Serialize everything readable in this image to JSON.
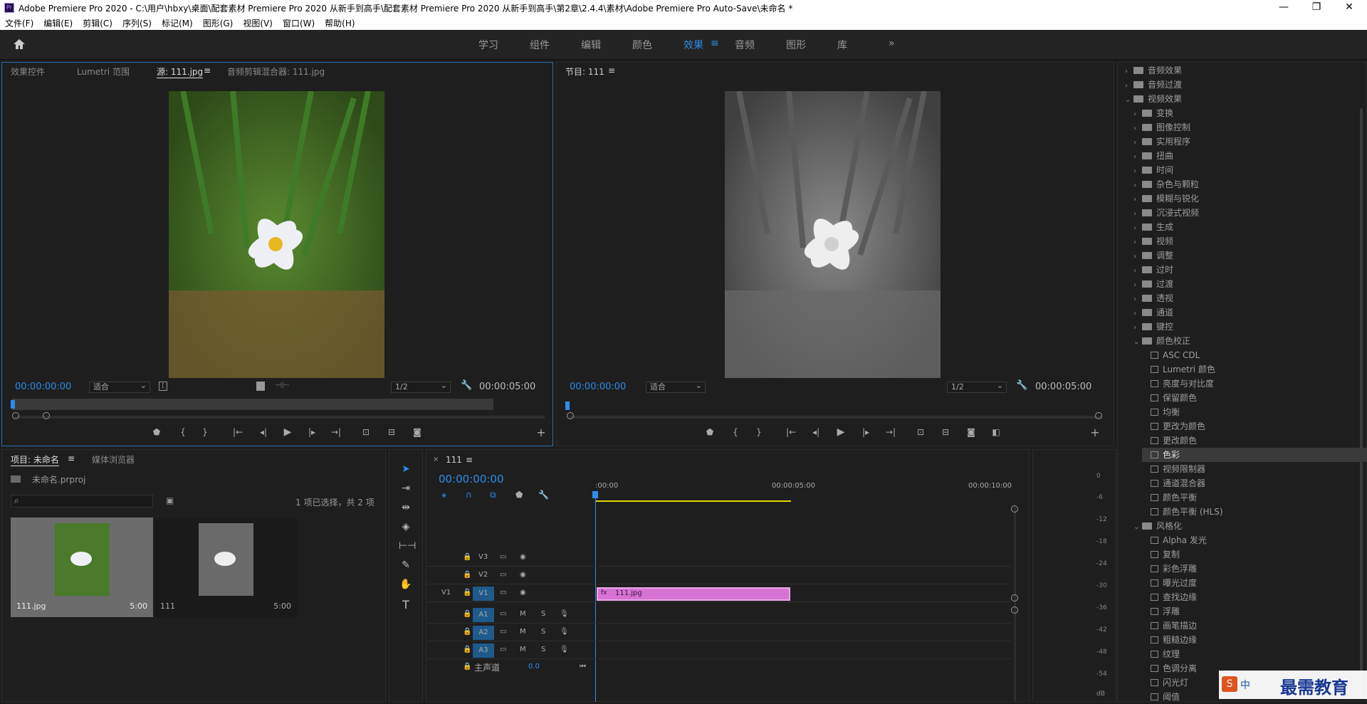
{
  "window": {
    "title": "Adobe Premiere Pro 2020 - C:\\用户\\hbxy\\桌面\\配套素材 Premiere Pro 2020 从新手到高手\\配套素材 Premiere Pro 2020 从新手到高手\\第2章\\2.4.4\\素材\\Adobe Premiere Pro Auto-Save\\未命名 *",
    "icon": "Pr"
  },
  "menu": [
    "文件(F)",
    "编辑(E)",
    "剪辑(C)",
    "序列(S)",
    "标记(M)",
    "图形(G)",
    "视图(V)",
    "窗口(W)",
    "帮助(H)"
  ],
  "workspaces": [
    "学习",
    "组件",
    "编辑",
    "颜色",
    "效果",
    "音频",
    "图形",
    "库"
  ],
  "workspace_active": "效果",
  "source": {
    "tabs": [
      "效果控件",
      "Lumetri 范围",
      "源: 111.jpg",
      "音频剪辑混合器: 111.jpg"
    ],
    "timecode": "00:00:00:00",
    "fit": "适合",
    "res": "1/2",
    "duration": "00:00:05:00"
  },
  "program": {
    "tab": "节目: 111",
    "timecode": "00:00:00:00",
    "fit": "适合",
    "res": "1/2",
    "duration": "00:00:05:00"
  },
  "project": {
    "tabs": [
      "项目: 未命名",
      "媒体浏览器"
    ],
    "file": "未命名.prproj",
    "selection": "1 项已选择，共 2 项",
    "items": [
      {
        "name": "111.jpg",
        "dur": "5:00"
      },
      {
        "name": "111",
        "dur": "5:00"
      }
    ]
  },
  "timeline": {
    "tab": "111",
    "timecode": "00:00:00:00",
    "ruler": [
      ":00:00",
      "00:00:05:00",
      "00:00:10:00"
    ],
    "video_tracks": [
      "V3",
      "V2",
      "V1"
    ],
    "audio_tracks": [
      "A1",
      "A2",
      "A3"
    ],
    "src_patch": "V1",
    "master": "主声道",
    "master_val": "0.0",
    "clip": "111.jpg"
  },
  "meter": [
    "0",
    "-6",
    "-12",
    "-18",
    "-24",
    "-30",
    "-36",
    "-42",
    "-48",
    "-54",
    "dB"
  ],
  "effects": [
    {
      "l": 0,
      "t": "folder",
      "open": false,
      "n": "音频效果"
    },
    {
      "l": 0,
      "t": "folder",
      "open": false,
      "n": "音频过渡"
    },
    {
      "l": 0,
      "t": "folder",
      "open": true,
      "n": "视频效果"
    },
    {
      "l": 1,
      "t": "folder",
      "open": false,
      "n": "变换"
    },
    {
      "l": 1,
      "t": "folder",
      "open": false,
      "n": "图像控制"
    },
    {
      "l": 1,
      "t": "folder",
      "open": false,
      "n": "实用程序"
    },
    {
      "l": 1,
      "t": "folder",
      "open": false,
      "n": "扭曲"
    },
    {
      "l": 1,
      "t": "folder",
      "open": false,
      "n": "时间"
    },
    {
      "l": 1,
      "t": "folder",
      "open": false,
      "n": "杂色与颗粒"
    },
    {
      "l": 1,
      "t": "folder",
      "open": false,
      "n": "模糊与锐化"
    },
    {
      "l": 1,
      "t": "folder",
      "open": false,
      "n": "沉浸式视频"
    },
    {
      "l": 1,
      "t": "folder",
      "open": false,
      "n": "生成"
    },
    {
      "l": 1,
      "t": "folder",
      "open": false,
      "n": "视频"
    },
    {
      "l": 1,
      "t": "folder",
      "open": false,
      "n": "调整"
    },
    {
      "l": 1,
      "t": "folder",
      "open": false,
      "n": "过时"
    },
    {
      "l": 1,
      "t": "folder",
      "open": false,
      "n": "过渡"
    },
    {
      "l": 1,
      "t": "folder",
      "open": false,
      "n": "透视"
    },
    {
      "l": 1,
      "t": "folder",
      "open": false,
      "n": "通道"
    },
    {
      "l": 1,
      "t": "folder",
      "open": false,
      "n": "键控"
    },
    {
      "l": 1,
      "t": "folder",
      "open": true,
      "n": "颜色校正"
    },
    {
      "l": 2,
      "t": "fx",
      "n": "ASC CDL"
    },
    {
      "l": 2,
      "t": "fx",
      "n": "Lumetri 颜色"
    },
    {
      "l": 2,
      "t": "fx",
      "n": "亮度与对比度"
    },
    {
      "l": 2,
      "t": "fx",
      "n": "保留颜色"
    },
    {
      "l": 2,
      "t": "fx",
      "n": "均衡"
    },
    {
      "l": 2,
      "t": "fx",
      "n": "更改为颜色"
    },
    {
      "l": 2,
      "t": "fx",
      "n": "更改颜色"
    },
    {
      "l": 2,
      "t": "fx",
      "n": "色彩",
      "sel": true
    },
    {
      "l": 2,
      "t": "fx",
      "n": "视频限制器"
    },
    {
      "l": 2,
      "t": "fx",
      "n": "通道混合器"
    },
    {
      "l": 2,
      "t": "fx",
      "n": "颜色平衡"
    },
    {
      "l": 2,
      "t": "fx",
      "n": "颜色平衡 (HLS)"
    },
    {
      "l": 1,
      "t": "folder",
      "open": true,
      "n": "风格化"
    },
    {
      "l": 2,
      "t": "fx",
      "n": "Alpha 发光"
    },
    {
      "l": 2,
      "t": "fx",
      "n": "复制"
    },
    {
      "l": 2,
      "t": "fx",
      "n": "彩色浮雕"
    },
    {
      "l": 2,
      "t": "fx",
      "n": "曝光过度"
    },
    {
      "l": 2,
      "t": "fx",
      "n": "查找边缘"
    },
    {
      "l": 2,
      "t": "fx",
      "n": "浮雕"
    },
    {
      "l": 2,
      "t": "fx",
      "n": "画笔描边"
    },
    {
      "l": 2,
      "t": "fx",
      "n": "粗糙边缘"
    },
    {
      "l": 2,
      "t": "fx",
      "n": "纹理"
    },
    {
      "l": 2,
      "t": "fx",
      "n": "色调分离"
    },
    {
      "l": 2,
      "t": "fx",
      "n": "闪光灯"
    },
    {
      "l": 2,
      "t": "fx",
      "n": "阈值"
    }
  ],
  "watermark": "最需教育",
  "ime": "中"
}
